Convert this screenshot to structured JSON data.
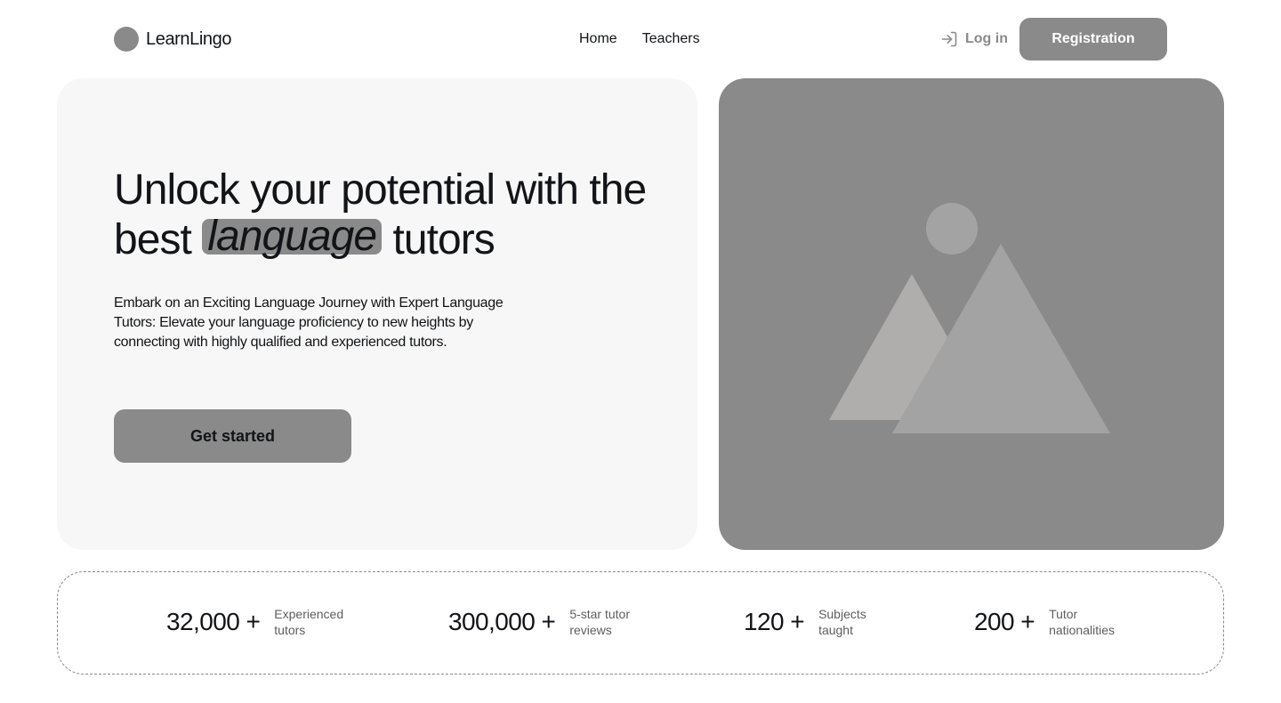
{
  "header": {
    "brand_name": "LearnLingo",
    "nav": [
      {
        "label": "Home"
      },
      {
        "label": "Teachers"
      }
    ],
    "login_label": "Log in",
    "register_label": "Registration"
  },
  "hero": {
    "title_before": "Unlock your potential with the best",
    "title_highlight": "language",
    "title_after": "tutors",
    "description": "Embark on an Exciting Language Journey with Expert Language Tutors: Elevate your language proficiency to new heights by connecting with highly qualified and experienced tutors.",
    "cta_label": "Get started"
  },
  "stats": [
    {
      "value": "32,000 +",
      "label": "Experienced\ntutors"
    },
    {
      "value": "300,000 +",
      "label": "5-star tutor\nreviews"
    },
    {
      "value": "120 +",
      "label": "Subjects\ntaught"
    },
    {
      "value": "200 +",
      "label": "Tutor\nnationalities"
    }
  ],
  "icons": {
    "brand": "logo-circle",
    "login": "login-arrow-icon",
    "hero_image": "image-placeholder-icon"
  },
  "colors": {
    "text": "#121417",
    "accent_placeholder": "#8a8a8a",
    "hero_bg": "#f7f7f7",
    "muted": "#5e5e5e"
  }
}
